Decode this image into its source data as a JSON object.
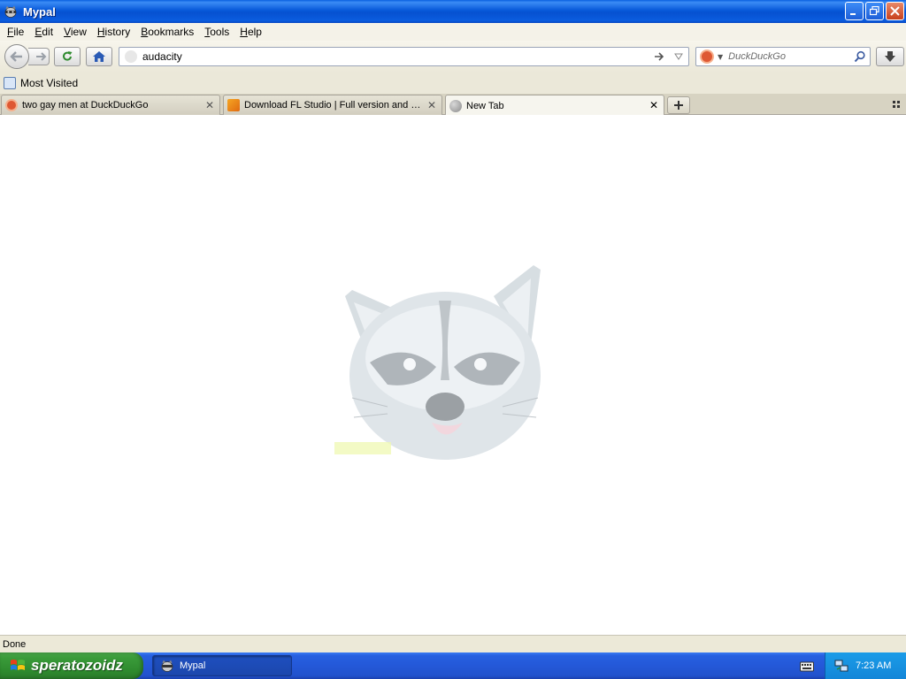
{
  "window": {
    "title": "Mypal"
  },
  "menu": [
    {
      "label": "File",
      "key": "F",
      "rest": "ile"
    },
    {
      "label": "Edit",
      "key": "E",
      "rest": "dit"
    },
    {
      "label": "View",
      "key": "V",
      "rest": "iew"
    },
    {
      "label": "History",
      "key": "H",
      "rest": "istory"
    },
    {
      "label": "Bookmarks",
      "key": "B",
      "rest": "ookmarks"
    },
    {
      "label": "Tools",
      "key": "T",
      "rest": "ools"
    },
    {
      "label": "Help",
      "key": "H",
      "rest": "elp"
    }
  ],
  "navbar": {
    "url_value": "audacity",
    "search_placeholder": "DuckDuckGo"
  },
  "bookmarks": {
    "most_visited": "Most Visited"
  },
  "tabs": [
    {
      "label": "two gay men at DuckDuckGo",
      "active": false
    },
    {
      "label": "Download FL Studio | Full version and Fre...",
      "active": false
    },
    {
      "label": "New Tab",
      "active": true
    }
  ],
  "status": {
    "text": "Done"
  },
  "taskbar": {
    "start_label": "speratozoidz",
    "task_label": "Mypal",
    "clock": "7:23 AM"
  },
  "colors": {
    "titlebar": "#0859d9",
    "taskbar": "#2458d8",
    "start": "#3a9b3a",
    "tray": "#1386d8"
  }
}
